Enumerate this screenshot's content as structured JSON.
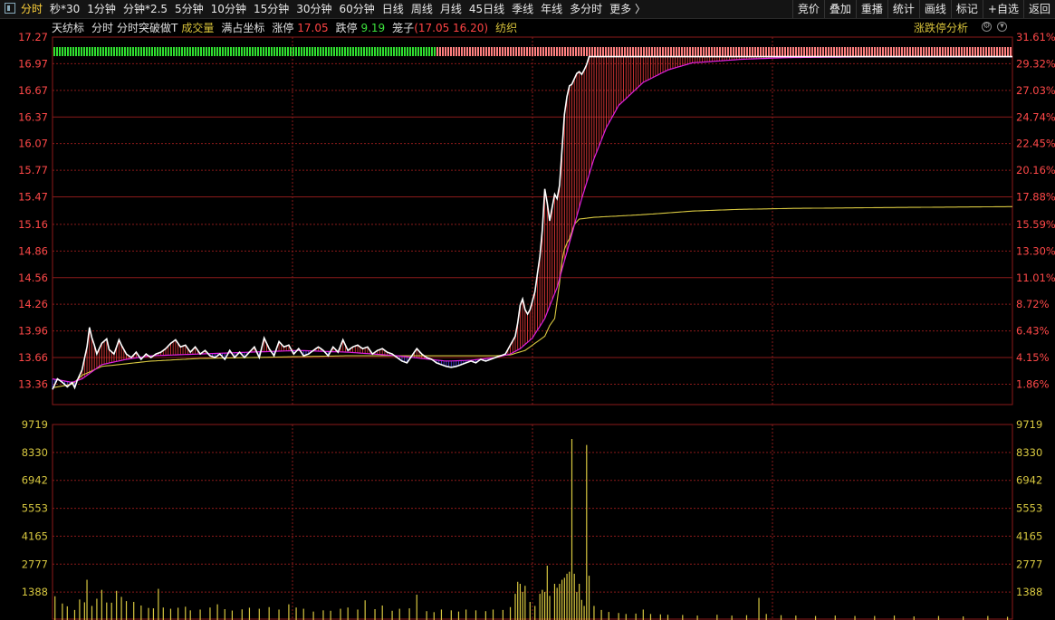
{
  "toolbar": {
    "tabs": [
      "分时",
      "秒*30",
      "1分钟",
      "分钟*2.5",
      "5分钟",
      "10分钟",
      "15分钟",
      "30分钟",
      "60分钟",
      "日线",
      "周线",
      "月线",
      "45日线",
      "季线",
      "年线",
      "多分时",
      "更多 〉"
    ],
    "active_tab": "分时",
    "right_buttons": [
      "竞价",
      "叠加",
      "重播",
      "统计",
      "画线",
      "标记",
      "+自选",
      "返回"
    ]
  },
  "info": {
    "stock_name": "天纺标",
    "mode": "分时",
    "indicator": "分时突破做T",
    "volume_label": "成交量",
    "coord_label": "满占坐标",
    "limit_up_label": "涨停",
    "limit_up_value": "17.05",
    "limit_down_label": "跌停",
    "limit_down_value": "9.19",
    "cage_label": "笼子",
    "cage_value": "(17.05 16.20)",
    "sector": "纺织",
    "limit_analysis_button": "涨跌停分析"
  },
  "colors": {
    "price_line": "#ffffff",
    "avg_line": "#d8c840",
    "magenta_line": "#e020e0",
    "up_color": "#ff4040",
    "down_color": "#20e020",
    "volume_bar": "#d8c840",
    "grid": "#8b1a1a"
  },
  "chart_data": {
    "type": "line",
    "price_axis_labels": [
      "17.27",
      "16.97",
      "16.67",
      "16.37",
      "16.07",
      "15.77",
      "15.47",
      "15.16",
      "14.86",
      "14.56",
      "14.26",
      "13.96",
      "13.66",
      "13.36"
    ],
    "pct_axis_labels": [
      "31.61%",
      "29.32%",
      "27.03%",
      "24.74%",
      "22.45%",
      "20.16%",
      "17.88%",
      "15.59%",
      "13.30%",
      "11.01%",
      "8.72%",
      "6.43%",
      "4.15%",
      "1.86%"
    ],
    "price_range": [
      13.13,
      17.27
    ],
    "volume_axis_labels": [
      "9719",
      "8330",
      "6942",
      "5553",
      "4165",
      "2777",
      "1388"
    ],
    "volume_range": [
      0,
      9719
    ],
    "series": [
      {
        "key": "price",
        "points": [
          [
            0,
            13.3
          ],
          [
            2,
            13.42
          ],
          [
            4,
            13.38
          ],
          [
            6,
            13.33
          ],
          [
            8,
            13.38
          ],
          [
            9,
            13.32
          ],
          [
            10,
            13.4
          ],
          [
            12,
            13.52
          ],
          [
            14,
            13.78
          ],
          [
            15,
            14.0
          ],
          [
            16,
            13.88
          ],
          [
            17,
            13.8
          ],
          [
            18,
            13.7
          ],
          [
            20,
            13.82
          ],
          [
            22,
            13.87
          ],
          [
            23,
            13.75
          ],
          [
            25,
            13.7
          ],
          [
            27,
            13.86
          ],
          [
            28,
            13.8
          ],
          [
            30,
            13.7
          ],
          [
            32,
            13.66
          ],
          [
            34,
            13.72
          ],
          [
            36,
            13.64
          ],
          [
            38,
            13.7
          ],
          [
            40,
            13.66
          ],
          [
            42,
            13.7
          ],
          [
            44,
            13.72
          ],
          [
            46,
            13.76
          ],
          [
            48,
            13.82
          ],
          [
            50,
            13.86
          ],
          [
            52,
            13.78
          ],
          [
            54,
            13.8
          ],
          [
            56,
            13.72
          ],
          [
            58,
            13.78
          ],
          [
            60,
            13.7
          ],
          [
            62,
            13.74
          ],
          [
            64,
            13.68
          ],
          [
            66,
            13.66
          ],
          [
            68,
            13.7
          ],
          [
            70,
            13.64
          ],
          [
            72,
            13.74
          ],
          [
            74,
            13.66
          ],
          [
            76,
            13.72
          ],
          [
            78,
            13.66
          ],
          [
            80,
            13.72
          ],
          [
            82,
            13.78
          ],
          [
            84,
            13.66
          ],
          [
            86,
            13.88
          ],
          [
            88,
            13.76
          ],
          [
            90,
            13.68
          ],
          [
            92,
            13.84
          ],
          [
            94,
            13.78
          ],
          [
            96,
            13.8
          ],
          [
            98,
            13.7
          ],
          [
            100,
            13.76
          ],
          [
            102,
            13.68
          ],
          [
            104,
            13.7
          ],
          [
            106,
            13.74
          ],
          [
            108,
            13.78
          ],
          [
            110,
            13.74
          ],
          [
            112,
            13.68
          ],
          [
            114,
            13.78
          ],
          [
            116,
            13.72
          ],
          [
            118,
            13.86
          ],
          [
            120,
            13.74
          ],
          [
            122,
            13.78
          ],
          [
            124,
            13.8
          ],
          [
            126,
            13.76
          ],
          [
            128,
            13.78
          ],
          [
            130,
            13.7
          ],
          [
            132,
            13.74
          ],
          [
            134,
            13.76
          ],
          [
            136,
            13.72
          ],
          [
            138,
            13.7
          ],
          [
            140,
            13.66
          ],
          [
            142,
            13.62
          ],
          [
            144,
            13.6
          ],
          [
            146,
            13.68
          ],
          [
            148,
            13.76
          ],
          [
            150,
            13.7
          ],
          [
            152,
            13.66
          ],
          [
            154,
            13.64
          ],
          [
            156,
            13.6
          ],
          [
            158,
            13.58
          ],
          [
            160,
            13.56
          ],
          [
            162,
            13.55
          ],
          [
            164,
            13.56
          ],
          [
            166,
            13.58
          ],
          [
            168,
            13.6
          ],
          [
            170,
            13.62
          ],
          [
            172,
            13.6
          ],
          [
            174,
            13.64
          ],
          [
            176,
            13.62
          ],
          [
            178,
            13.64
          ],
          [
            180,
            13.66
          ],
          [
            182,
            13.68
          ],
          [
            184,
            13.7
          ],
          [
            186,
            13.8
          ],
          [
            188,
            13.9
          ],
          [
            189,
            14.05
          ],
          [
            190,
            14.25
          ],
          [
            191,
            14.32
          ],
          [
            192,
            14.2
          ],
          [
            193,
            14.15
          ],
          [
            194,
            14.2
          ],
          [
            196,
            14.4
          ],
          [
            198,
            14.8
          ],
          [
            199,
            15.1
          ],
          [
            200,
            15.56
          ],
          [
            201,
            15.4
          ],
          [
            202,
            15.2
          ],
          [
            203,
            15.35
          ],
          [
            204,
            15.5
          ],
          [
            205,
            15.45
          ],
          [
            206,
            15.6
          ],
          [
            207,
            16.0
          ],
          [
            208,
            16.4
          ],
          [
            209,
            16.6
          ],
          [
            210,
            16.72
          ],
          [
            211,
            16.74
          ],
          [
            212,
            16.8
          ],
          [
            213,
            16.86
          ],
          [
            214,
            16.88
          ],
          [
            215,
            16.85
          ],
          [
            216,
            16.9
          ],
          [
            217,
            16.96
          ],
          [
            218,
            17.05
          ],
          [
            390,
            17.05
          ]
        ]
      },
      {
        "key": "avg",
        "points": [
          [
            0,
            13.32
          ],
          [
            8,
            13.36
          ],
          [
            12,
            13.46
          ],
          [
            20,
            13.56
          ],
          [
            40,
            13.62
          ],
          [
            60,
            13.65
          ],
          [
            80,
            13.66
          ],
          [
            120,
            13.68
          ],
          [
            160,
            13.68
          ],
          [
            180,
            13.68
          ],
          [
            186,
            13.69
          ],
          [
            192,
            13.74
          ],
          [
            196,
            13.82
          ],
          [
            200,
            13.9
          ],
          [
            202,
            14.02
          ],
          [
            204,
            14.1
          ],
          [
            205,
            14.3
          ],
          [
            206,
            14.5
          ],
          [
            207,
            14.75
          ],
          [
            208,
            14.88
          ],
          [
            209,
            14.95
          ],
          [
            210,
            15.0
          ],
          [
            212,
            15.16
          ],
          [
            214,
            15.22
          ],
          [
            220,
            15.24
          ],
          [
            240,
            15.27
          ],
          [
            260,
            15.31
          ],
          [
            280,
            15.33
          ],
          [
            300,
            15.34
          ],
          [
            340,
            15.35
          ],
          [
            390,
            15.36
          ]
        ]
      },
      {
        "key": "magenta",
        "points": [
          [
            0,
            13.42
          ],
          [
            4,
            13.4
          ],
          [
            8,
            13.38
          ],
          [
            12,
            13.42
          ],
          [
            16,
            13.5
          ],
          [
            20,
            13.58
          ],
          [
            30,
            13.64
          ],
          [
            40,
            13.68
          ],
          [
            60,
            13.7
          ],
          [
            80,
            13.72
          ],
          [
            100,
            13.74
          ],
          [
            120,
            13.72
          ],
          [
            140,
            13.68
          ],
          [
            160,
            13.62
          ],
          [
            170,
            13.63
          ],
          [
            180,
            13.66
          ],
          [
            186,
            13.7
          ],
          [
            190,
            13.76
          ],
          [
            195,
            13.88
          ],
          [
            200,
            14.1
          ],
          [
            205,
            14.45
          ],
          [
            210,
            14.95
          ],
          [
            215,
            15.45
          ],
          [
            220,
            15.9
          ],
          [
            225,
            16.25
          ],
          [
            230,
            16.5
          ],
          [
            240,
            16.76
          ],
          [
            250,
            16.9
          ],
          [
            260,
            16.98
          ],
          [
            280,
            17.02
          ],
          [
            300,
            17.04
          ],
          [
            340,
            17.05
          ],
          [
            390,
            17.05
          ]
        ]
      }
    ],
    "volume": [
      [
        1,
        1180
      ],
      [
        4,
        820
      ],
      [
        6,
        680
      ],
      [
        9,
        500
      ],
      [
        11,
        1020
      ],
      [
        13,
        880
      ],
      [
        14,
        2000
      ],
      [
        16,
        700
      ],
      [
        18,
        1060
      ],
      [
        20,
        1500
      ],
      [
        22,
        870
      ],
      [
        24,
        860
      ],
      [
        26,
        1450
      ],
      [
        28,
        1150
      ],
      [
        30,
        940
      ],
      [
        33,
        900
      ],
      [
        36,
        720
      ],
      [
        39,
        600
      ],
      [
        41,
        580
      ],
      [
        43,
        1550
      ],
      [
        45,
        620
      ],
      [
        48,
        560
      ],
      [
        51,
        610
      ],
      [
        54,
        660
      ],
      [
        56,
        480
      ],
      [
        60,
        520
      ],
      [
        64,
        620
      ],
      [
        67,
        780
      ],
      [
        70,
        540
      ],
      [
        73,
        470
      ],
      [
        77,
        530
      ],
      [
        80,
        610
      ],
      [
        84,
        560
      ],
      [
        88,
        640
      ],
      [
        92,
        520
      ],
      [
        96,
        780
      ],
      [
        99,
        620
      ],
      [
        102,
        560
      ],
      [
        106,
        420
      ],
      [
        110,
        480
      ],
      [
        113,
        460
      ],
      [
        117,
        560
      ],
      [
        120,
        620
      ],
      [
        124,
        520
      ],
      [
        127,
        980
      ],
      [
        131,
        540
      ],
      [
        134,
        720
      ],
      [
        138,
        460
      ],
      [
        141,
        560
      ],
      [
        145,
        580
      ],
      [
        148,
        1260
      ],
      [
        152,
        440
      ],
      [
        155,
        390
      ],
      [
        158,
        520
      ],
      [
        162,
        480
      ],
      [
        165,
        420
      ],
      [
        168,
        520
      ],
      [
        172,
        480
      ],
      [
        176,
        440
      ],
      [
        179,
        520
      ],
      [
        183,
        500
      ],
      [
        186,
        640
      ],
      [
        188,
        1300
      ],
      [
        189,
        1900
      ],
      [
        190,
        1800
      ],
      [
        191,
        1400
      ],
      [
        192,
        1700
      ],
      [
        194,
        900
      ],
      [
        196,
        700
      ],
      [
        198,
        1300
      ],
      [
        199,
        1500
      ],
      [
        200,
        1400
      ],
      [
        201,
        2700
      ],
      [
        202,
        1200
      ],
      [
        204,
        1800
      ],
      [
        205,
        1600
      ],
      [
        206,
        1800
      ],
      [
        207,
        2000
      ],
      [
        208,
        2100
      ],
      [
        209,
        2300
      ],
      [
        210,
        2400
      ],
      [
        211,
        9000
      ],
      [
        212,
        2300
      ],
      [
        213,
        1400
      ],
      [
        214,
        1800
      ],
      [
        215,
        1000
      ],
      [
        216,
        700
      ],
      [
        217,
        8700
      ],
      [
        218,
        2200
      ],
      [
        220,
        700
      ],
      [
        223,
        500
      ],
      [
        226,
        400
      ],
      [
        230,
        350
      ],
      [
        233,
        300
      ],
      [
        237,
        320
      ],
      [
        240,
        520
      ],
      [
        243,
        300
      ],
      [
        247,
        280
      ],
      [
        250,
        260
      ],
      [
        256,
        250
      ],
      [
        262,
        220
      ],
      [
        270,
        260
      ],
      [
        276,
        220
      ],
      [
        282,
        240
      ],
      [
        287,
        1100
      ],
      [
        290,
        300
      ],
      [
        296,
        240
      ],
      [
        302,
        220
      ],
      [
        310,
        200
      ],
      [
        318,
        220
      ],
      [
        326,
        200
      ],
      [
        334,
        200
      ],
      [
        342,
        220
      ],
      [
        350,
        180
      ],
      [
        360,
        200
      ],
      [
        370,
        180
      ],
      [
        380,
        200
      ],
      [
        388,
        160
      ]
    ],
    "strip": {
      "green_end_fraction": 0.4
    }
  }
}
